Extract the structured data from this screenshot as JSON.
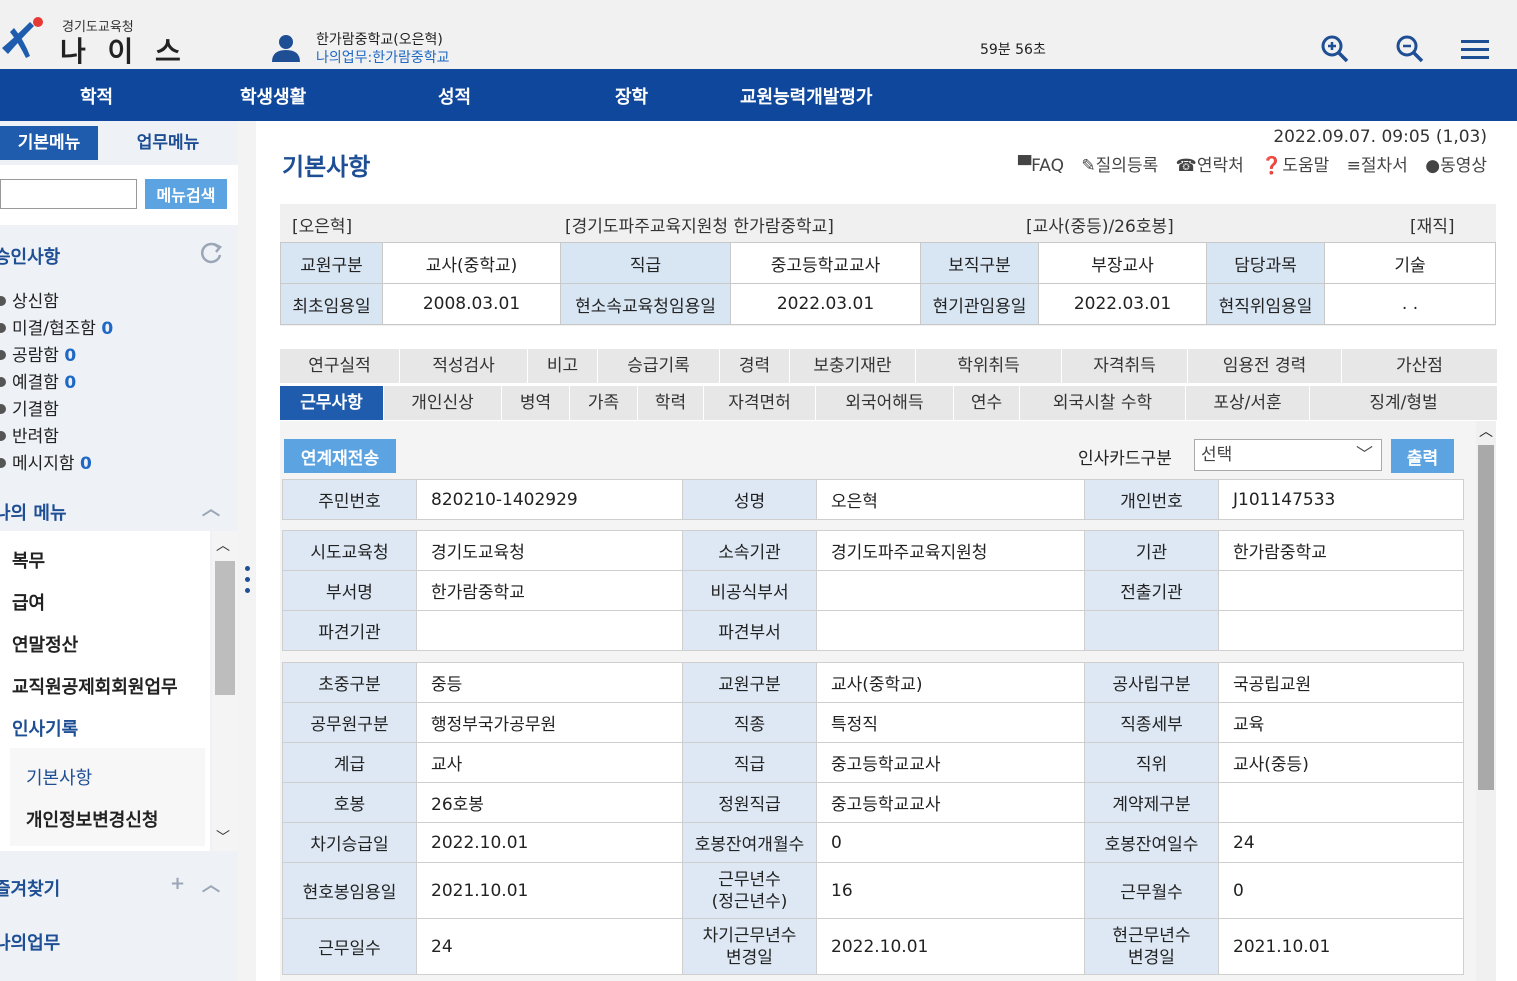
{
  "header": {
    "org": "경기도교육청",
    "app_name": "나 이 스",
    "user_name": "한가람중학교(오은혁)",
    "user_role": "나의업무:한가람중학교",
    "session_timer": "59분 56초"
  },
  "topnav": [
    "학적",
    "학생생활",
    "성적",
    "장학",
    "교원능력개발평가"
  ],
  "left": {
    "tab_basic": "기본메뉴",
    "tab_work": "업무메뉴",
    "search_btn": "메뉴검색",
    "approval_title": "승인사항",
    "approvals": [
      {
        "label": "상신함",
        "count": ""
      },
      {
        "label": "미결/협조함",
        "count": "0"
      },
      {
        "label": "공람함",
        "count": "0"
      },
      {
        "label": "예결함",
        "count": "0"
      },
      {
        "label": "기결함",
        "count": ""
      },
      {
        "label": "반려함",
        "count": ""
      },
      {
        "label": "메시지함",
        "count": "0"
      }
    ],
    "mymenu_title": "나의 메뉴",
    "mymenu": [
      "복무",
      "급여",
      "연말정산",
      "교직원공제회회원업무",
      "인사기록",
      "기본사항",
      "개인정보변경신청"
    ],
    "favorites_title": "즐겨찾기",
    "mywork_title": "나의업무"
  },
  "main": {
    "title": "기본사항",
    "datetime": "2022.09.07. 09:05 (1,03)",
    "links": [
      "▀FAQ",
      "✎질의등록",
      "☎연락처",
      "❓도움말",
      "≡절차서",
      "●동영상"
    ],
    "summary_top": [
      "[오은혁]",
      "[경기도파주교육지원청 한가람중학교]",
      "[교사(중등)/26호봉]",
      "[재직]"
    ],
    "summary_row1": [
      "교원구분",
      "교사(중학교)",
      "직급",
      "중고등학교교사",
      "보직구분",
      "부장교사",
      "담당과목",
      "기술"
    ],
    "summary_row2": [
      "최초임용일",
      "2008.03.01",
      "현소속교육청임용일",
      "2022.03.01",
      "현기관임용일",
      "2022.03.01",
      "현직위임용일",
      ". ."
    ],
    "tabs_row1": [
      "연구실적",
      "적성검사",
      "비고",
      "승급기록",
      "경력",
      "보충기재란",
      "학위취득",
      "자격취득",
      "임용전 경력",
      "가산점"
    ],
    "tabs_row2": [
      "근무사항",
      "개인신상",
      "병역",
      "가족",
      "학력",
      "자격면허",
      "외국어해득",
      "연수",
      "외국시찰 수학",
      "포상/서훈",
      "징계/형벌"
    ],
    "relay_btn": "연계재전송",
    "card_label": "인사카드구분",
    "card_value": "선택",
    "print_btn": "출력",
    "t1": [
      [
        "주민번호",
        "820210-1402929",
        "성명",
        "오은혁",
        "개인번호",
        "J101147533"
      ]
    ],
    "t2": [
      [
        "시도교육청",
        "경기도교육청",
        "소속기관",
        "경기도파주교육지원청",
        "기관",
        "한가람중학교"
      ],
      [
        "부서명",
        "한가람중학교",
        "비공식부서",
        "",
        "전출기관",
        ""
      ],
      [
        "파견기관",
        "",
        "파견부서",
        "",
        "",
        ""
      ]
    ],
    "t3": [
      [
        "초중구분",
        "중등",
        "교원구분",
        "교사(중학교)",
        "공사립구분",
        "국공립교원"
      ],
      [
        "공무원구분",
        "행정부국가공무원",
        "직종",
        "특정직",
        "직종세부",
        "교육"
      ],
      [
        "계급",
        "교사",
        "직급",
        "중고등학교교사",
        "직위",
        "교사(중등)"
      ],
      [
        "호봉",
        "26호봉",
        "정원직급",
        "중고등학교교사",
        "계약제구분",
        ""
      ],
      [
        "차기승급일",
        "2022.10.01",
        "호봉잔여개월수",
        "0",
        "호봉잔여일수",
        "24"
      ],
      [
        "현호봉임용일",
        "2021.10.01",
        "근무년수\n(정근년수)",
        "16",
        "근무월수",
        "0"
      ],
      [
        "근무일수",
        "24",
        "차기근무년수\n변경일",
        "2022.10.01",
        "현근무년수\n변경일",
        "2021.10.01"
      ]
    ]
  },
  "colors": {
    "nav": "#0f479c",
    "accent": "#1e4e94",
    "button": "#5ca3e2",
    "label_bg": "#dde8f4"
  }
}
